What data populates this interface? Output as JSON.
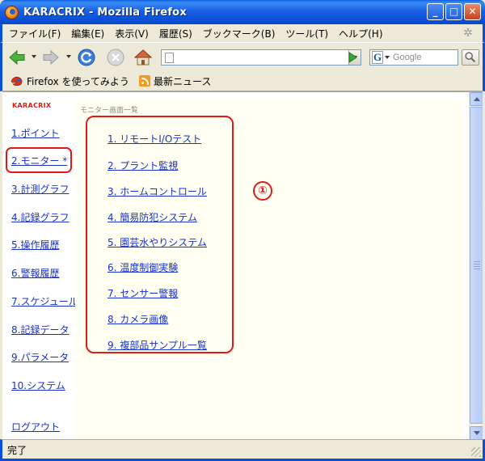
{
  "window": {
    "title": "KARACRIX - Mozilla Firefox",
    "minimize_glyph": "_",
    "maximize_glyph": "□",
    "close_glyph": "✕"
  },
  "menu": [
    "ファイル(F)",
    "編集(E)",
    "表示(V)",
    "履歴(S)",
    "ブックマーク(B)",
    "ツール(T)",
    "ヘルプ(H)"
  ],
  "toolbar": {
    "url_value": "",
    "search_placeholder": "Google",
    "search_engine_glyph": "G"
  },
  "bookmarks": [
    "Firefox を使ってみよう",
    "最新ニュース"
  ],
  "sidebar": {
    "brand": "KARACRIX",
    "items": [
      "1.ポイント",
      "2.モニター *",
      "3.計測グラフ",
      "4.記録グラフ",
      "5.操作履歴",
      "6.警報履歴",
      "7.スケジュール",
      "8.記録データ",
      "9.パラメータ",
      "10.システム"
    ],
    "logout": "ログアウト"
  },
  "main": {
    "heading": "モニター画面一覧",
    "links": [
      "1. リモートI/Oテスト",
      "2. プラント監視",
      "3. ホームコントロール",
      "4. 簡易防犯システム",
      "5. 園芸水やりシステム",
      "6. 温度制御実験",
      "7. センサー警報",
      "8. カメラ画像",
      "9. 複部品サンプル一覧"
    ],
    "callout": "①"
  },
  "status": {
    "text": "完了"
  },
  "colors": {
    "titlebar": "#0b4fd6",
    "link": "#1a32c8",
    "brand": "#d0221d",
    "highlight": "#e01919",
    "content_bg": "#fffff2",
    "chrome": "#ece9d8"
  }
}
